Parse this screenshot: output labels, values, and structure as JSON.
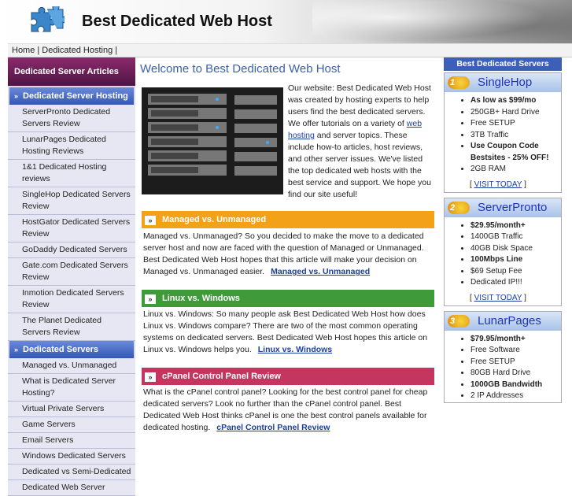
{
  "header": {
    "title": "Best Dedicated Web Host"
  },
  "breadcrumb": "Home | Dedicated Hosting |",
  "left": {
    "title": "Dedicated Server Articles",
    "sec1": "Dedicated Server Hosting",
    "items1": [
      "ServerPronto Dedicated Servers Review",
      "LunarPages Dedicated Hosting Reviews",
      "1&1 Dedicated Hosting reviews",
      "SingleHop Dedicated Servers Review",
      "HostGator Dedicated Servers Review",
      "GoDaddy Dedicated Servers",
      "Gate.com Dedicated Servers Review",
      "Inmotion Dedicated Servers Review",
      "The Planet Dedicated Servers Review"
    ],
    "sec2": "Dedicated Servers",
    "items2": [
      "Managed vs. Unmanaged",
      "What is Dedicated Server Hosting?",
      "Virtual Private Servers",
      "Game Servers",
      "Email Servers",
      "Windows Dedicated Servers",
      "Dedicated vs Semi-Dedicated",
      "Dedicated Web Server"
    ]
  },
  "main": {
    "title": "Welcome to Best Dedicated Web Host",
    "intro_a": "Our website: Best Dedicated Web Host was created by hosting experts to help users find the best dedicated servers. We offer tutorials on a variety of",
    "intro_link": "web hosting",
    "intro_b": "and server topics. These include how-to articles, host reviews, and other server issues. We've listed the top dedicated web hosts with the best service and support. We hope you find our site useful!",
    "sections": [
      {
        "heading": "Managed vs. Unmanaged",
        "text": "Managed vs. Unmanaged? So you decided to make the move to a dedicated server host and now are faced with the question of Managed or Unmanaged. Best Dedicated Web Host hopes that this article will make your decision on Managed vs. Unmanaged easier.",
        "link": "Managed vs. Unmanaged",
        "color": "#f4a11a"
      },
      {
        "heading": "Linux vs. Windows",
        "text": "Linux vs. Windows: So many people ask Best Dedicated Web Host how does Linux vs. Windows compare? There are two of the most common operating systems on dedicated servers. Best Dedicated Web Host hopes this article on Linux vs. Windows helps you.",
        "link": "Linux vs. Windows",
        "color": "#3f9a3a"
      },
      {
        "heading": "cPanel Control Panel Review",
        "text": "What is the cPanel control panel? Looking for the best control panel for cheap dedicated servers? Look no further than the cPanel control panel. Best Dedicated Web Host thinks cPanel is one the best control panels available for dedicated hosting.",
        "link": "cPanel Control Panel Review",
        "color": "#c4365f"
      }
    ]
  },
  "right": {
    "title": "Best Dedicated Servers",
    "hosts": [
      {
        "rank": "1",
        "name": "SingleHop",
        "features": [
          {
            "t": "As low as $99/mo",
            "b": true
          },
          {
            "t": "250GB+ Hard Drive",
            "b": false
          },
          {
            "t": "Free SETUP",
            "b": false
          },
          {
            "t": "3TB Traffic",
            "b": false
          },
          {
            "t": "Use Coupon Code Bestsites - 25% OFF!",
            "b": true
          },
          {
            "t": "2GB RAM",
            "b": false
          }
        ],
        "visit": "VISIT TODAY"
      },
      {
        "rank": "2",
        "name": "ServerPronto",
        "features": [
          {
            "t": "$29.95/month+",
            "b": true
          },
          {
            "t": "1400GB Traffic",
            "b": false
          },
          {
            "t": "40GB Disk Space",
            "b": false
          },
          {
            "t": "100Mbps Line",
            "b": true
          },
          {
            "t": "$69 Setup Fee",
            "b": false
          },
          {
            "t": "Dedicated IP!!!",
            "b": false
          }
        ],
        "visit": "VISIT TODAY"
      },
      {
        "rank": "3",
        "name": "LunarPages",
        "features": [
          {
            "t": "$79.95/month+",
            "b": true
          },
          {
            "t": "Free Software",
            "b": false
          },
          {
            "t": "Free SETUP",
            "b": false
          },
          {
            "t": "80GB Hard Drive",
            "b": false
          },
          {
            "t": "1000GB Bandwidth",
            "b": true
          },
          {
            "t": "2 IP Addresses",
            "b": false
          }
        ]
      }
    ]
  }
}
